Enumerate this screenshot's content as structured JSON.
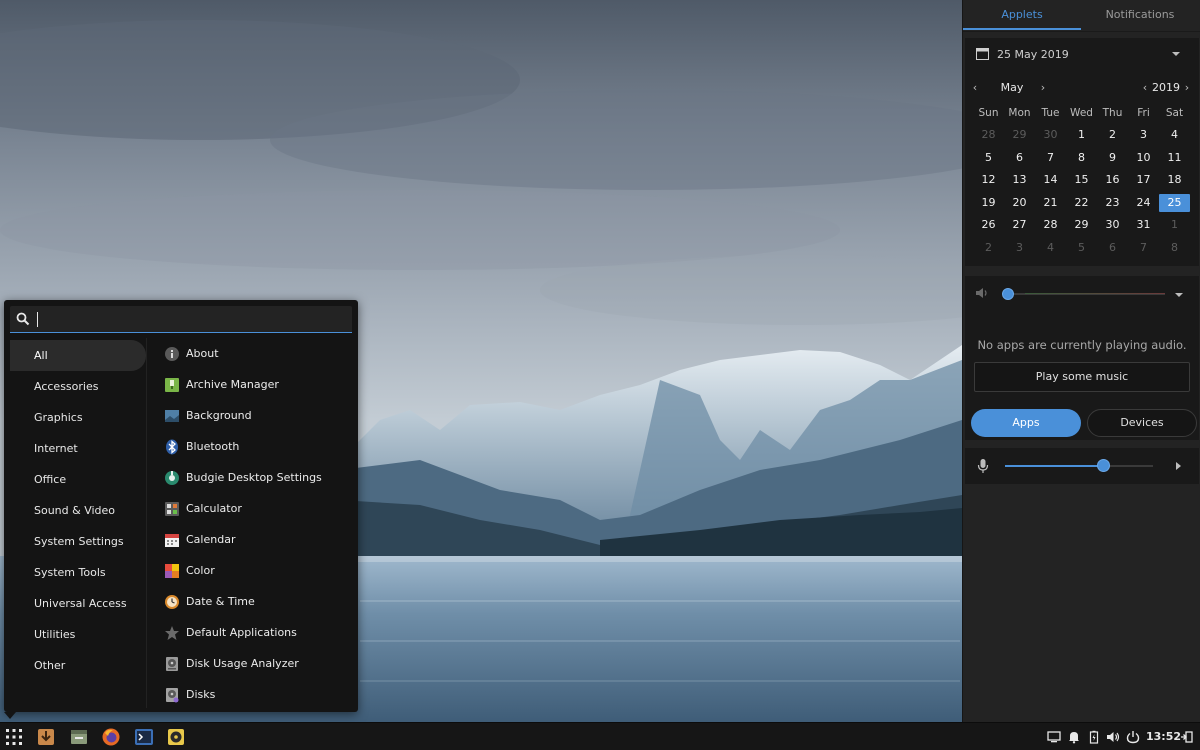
{
  "search": {
    "value": "",
    "placeholder": ""
  },
  "menu": {
    "categories": [
      {
        "label": "All",
        "active": true
      },
      {
        "label": "Accessories"
      },
      {
        "label": "Graphics"
      },
      {
        "label": "Internet"
      },
      {
        "label": "Office"
      },
      {
        "label": "Sound & Video"
      },
      {
        "label": "System Settings"
      },
      {
        "label": "System Tools"
      },
      {
        "label": "Universal Access"
      },
      {
        "label": "Utilities"
      },
      {
        "label": "Other"
      }
    ],
    "apps": [
      {
        "label": "About",
        "icon": "info-icon"
      },
      {
        "label": "Archive Manager",
        "icon": "archive-icon"
      },
      {
        "label": "Background",
        "icon": "background-icon"
      },
      {
        "label": "Bluetooth",
        "icon": "bluetooth-icon"
      },
      {
        "label": "Budgie Desktop Settings",
        "icon": "budgie-settings-icon"
      },
      {
        "label": "Calculator",
        "icon": "calculator-icon"
      },
      {
        "label": "Calendar",
        "icon": "calendar-app-icon"
      },
      {
        "label": "Color",
        "icon": "color-icon"
      },
      {
        "label": "Date & Time",
        "icon": "clock-icon"
      },
      {
        "label": "Default Applications",
        "icon": "star-icon"
      },
      {
        "label": "Disk Usage Analyzer",
        "icon": "disk-usage-icon"
      },
      {
        "label": "Disks",
        "icon": "disks-icon"
      }
    ]
  },
  "raven": {
    "tabs": [
      {
        "label": "Applets",
        "active": true
      },
      {
        "label": "Notifications"
      }
    ],
    "calendar": {
      "date_label": "25 May 2019",
      "month": "May",
      "year": "2019",
      "weekdays": [
        "Sun",
        "Mon",
        "Tue",
        "Wed",
        "Thu",
        "Fri",
        "Sat"
      ],
      "weeks": [
        [
          "28",
          "29",
          "30",
          "1",
          "2",
          "3",
          "4"
        ],
        [
          "5",
          "6",
          "7",
          "8",
          "9",
          "10",
          "11"
        ],
        [
          "12",
          "13",
          "14",
          "15",
          "16",
          "17",
          "18"
        ],
        [
          "19",
          "20",
          "21",
          "22",
          "23",
          "24",
          "25"
        ],
        [
          "26",
          "27",
          "28",
          "29",
          "30",
          "31",
          "1"
        ],
        [
          "2",
          "3",
          "4",
          "5",
          "6",
          "7",
          "8"
        ]
      ],
      "today": "25"
    },
    "sound": {
      "output_volume": 0.0,
      "no_apps_text": "No apps are currently playing audio.",
      "play_button": "Play some music",
      "toggle_apps": "Apps",
      "toggle_devices": "Devices",
      "input_volume": 0.66
    }
  },
  "taskbar": {
    "launchers": [
      "app-menu-icon",
      "installer-icon",
      "files-icon",
      "firefox-icon",
      "terminal-icon",
      "rhythmbox-icon"
    ],
    "tray": [
      "display-icon",
      "notification-bell-icon",
      "battery-icon",
      "volume-icon",
      "power-icon"
    ],
    "clock": "13:52"
  },
  "colors": {
    "accent": "#4a90d9",
    "panel": "#232323",
    "menu": "#141414"
  }
}
